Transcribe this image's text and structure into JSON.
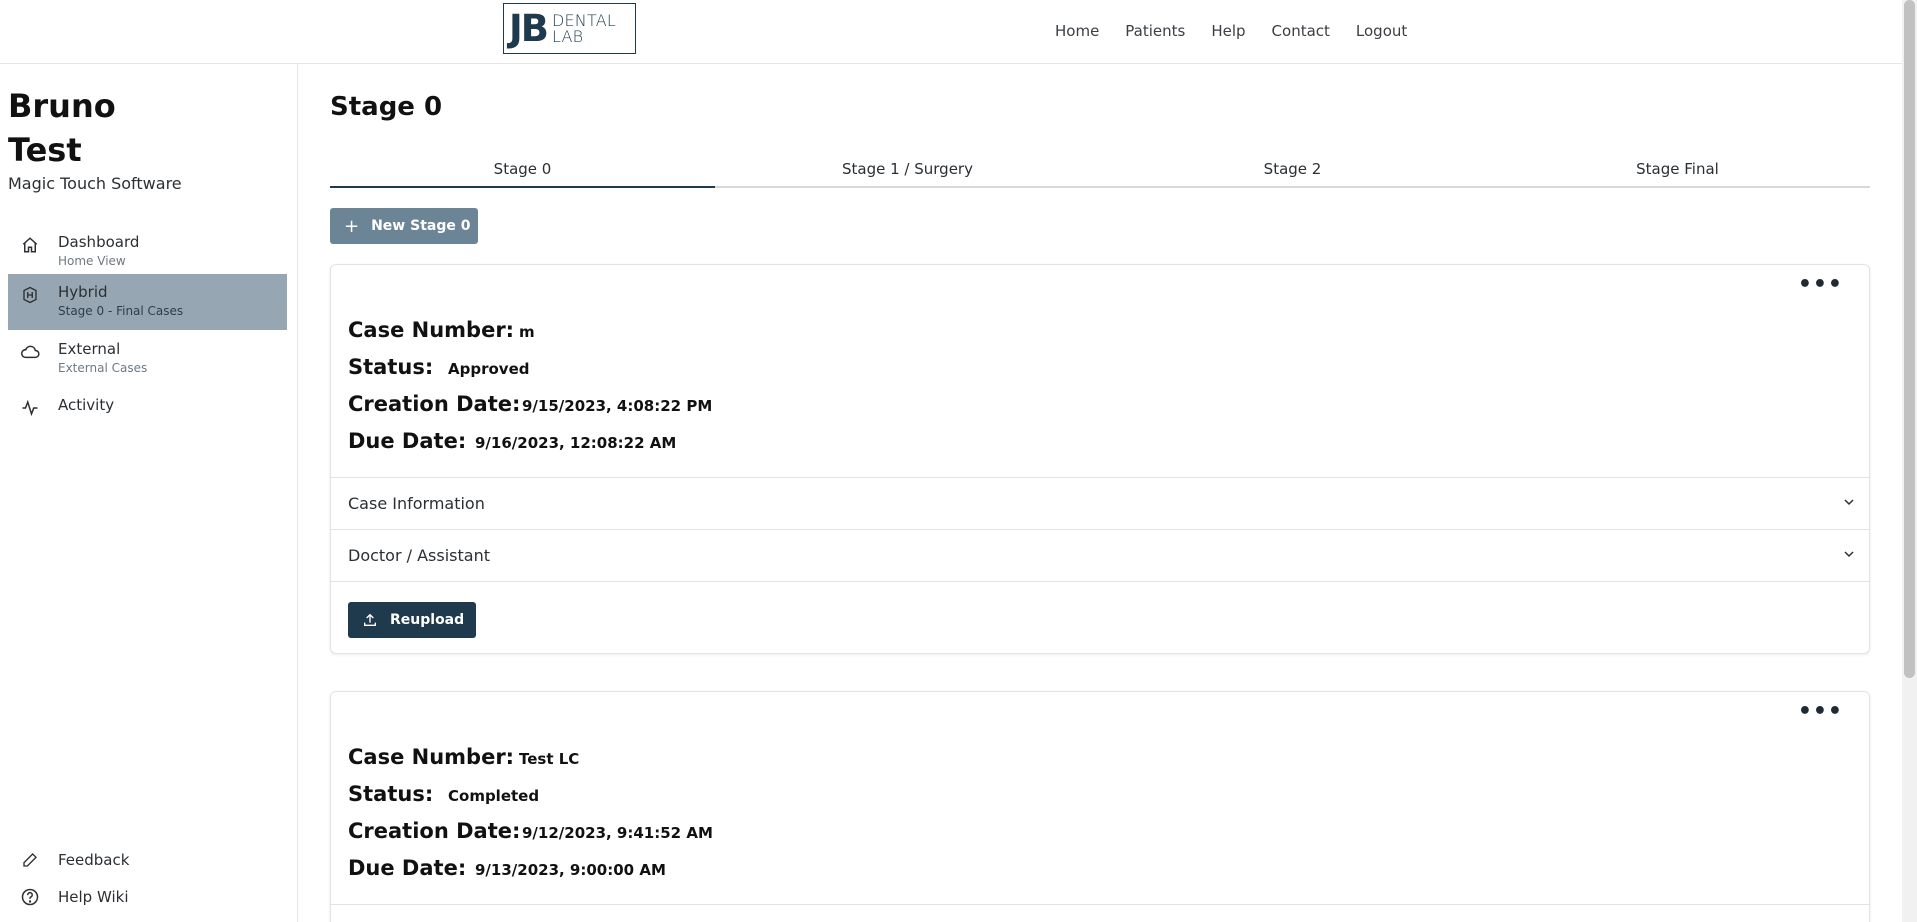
{
  "header": {
    "logo_mark": "JB",
    "logo_line1": "DENTAL",
    "logo_line2": "LAB",
    "nav": [
      "Home",
      "Patients",
      "Help",
      "Contact",
      "Logout"
    ]
  },
  "sidebar": {
    "user_first": "Bruno",
    "user_last": "Test",
    "company": "Magic Touch Software",
    "items": [
      {
        "title": "Dashboard",
        "sub": "Home View",
        "icon": "home-icon"
      },
      {
        "title": "Hybrid",
        "sub": "Stage 0 - Final Cases",
        "icon": "hybrid-badge-icon",
        "active": true
      },
      {
        "title": "External",
        "sub": "External Cases",
        "icon": "cloud-icon"
      },
      {
        "title": "Activity",
        "sub": "",
        "icon": "activity-icon"
      }
    ],
    "bottom": [
      {
        "title": "Feedback",
        "icon": "pencil-icon"
      },
      {
        "title": "Help Wiki",
        "icon": "help-circle-icon"
      }
    ]
  },
  "main": {
    "title": "Stage 0",
    "tabs": [
      "Stage 0",
      "Stage 1 / Surgery",
      "Stage 2",
      "Stage Final"
    ],
    "active_tab": 0,
    "new_button": "New Stage 0",
    "labels": {
      "case_number": "Case Number:",
      "status": "Status:",
      "creation_date": "Creation Date:",
      "due_date": "Due Date:"
    },
    "cards": [
      {
        "case_number": "m",
        "status": "Approved",
        "creation_date": "9/15/2023, 4:08:22 PM",
        "due_date": "9/16/2023, 12:08:22 AM",
        "sections": [
          "Case Information",
          "Doctor / Assistant"
        ],
        "action": "Reupload"
      },
      {
        "case_number": "Test LC",
        "status": "Completed",
        "creation_date": "9/12/2023, 9:41:52 AM",
        "due_date": "9/13/2023, 9:00:00 AM"
      }
    ]
  }
}
